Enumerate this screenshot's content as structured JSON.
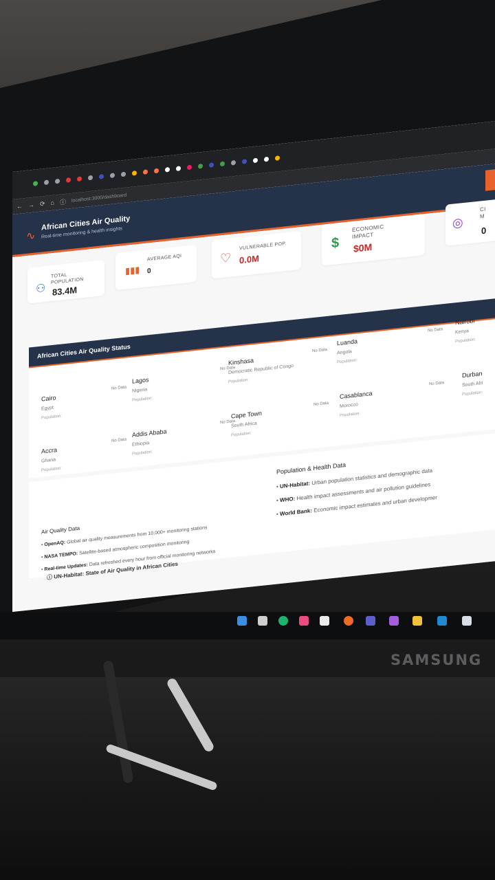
{
  "browser": {
    "url": "localhost:3000/dashboard"
  },
  "header": {
    "title": "African Cities Air Quality",
    "subtitle": "Real-time monitoring & health insights"
  },
  "stats": [
    {
      "label": "TOTAL POPULATION",
      "value": "83.4M",
      "icon": "people-icon",
      "color": "#3b6fd8"
    },
    {
      "label": "AVERAGE AQI",
      "value": "0",
      "icon": "bar-chart-icon",
      "color": "#e8632b"
    },
    {
      "label": "VULNERABLE POP.",
      "value": "0.0M",
      "icon": "heart-icon",
      "color": "#d93a3a"
    },
    {
      "label": "ECONOMIC IMPACT",
      "value": "$0M",
      "icon": "dollar-icon",
      "color": "#2e9a4b"
    },
    {
      "label": "CI M",
      "value": "0",
      "icon": "location-pin-icon",
      "color": "#9b3bd8"
    }
  ],
  "status": {
    "title": "African Cities Air Quality Status",
    "cities": [
      {
        "name": "Cairo",
        "country": "Egypt",
        "population": "Population:",
        "aqi": "No Data"
      },
      {
        "name": "Lagos",
        "country": "Nigeria",
        "population": "Population:",
        "aqi": "No Data"
      },
      {
        "name": "Kinshasa",
        "country": "Democratic Republic of Congo",
        "population": "Population:",
        "aqi": "No Data"
      },
      {
        "name": "Luanda",
        "country": "Angola",
        "population": "Population:",
        "aqi": "No Data"
      },
      {
        "name": "Nairobi",
        "country": "Kenya",
        "population": "Population:",
        "aqi": "No Data"
      },
      {
        "name": "Accra",
        "country": "Ghana",
        "population": "Population:",
        "aqi": "No Data"
      },
      {
        "name": "Addis Ababa",
        "country": "Ethiopia",
        "population": "Population:",
        "aqi": "No Data"
      },
      {
        "name": "Cape Town",
        "country": "South Africa",
        "population": "Population:",
        "aqi": "No Data"
      },
      {
        "name": "Casablanca",
        "country": "Morocco",
        "population": "Population:",
        "aqi": "No Data"
      },
      {
        "name": "Durban",
        "country": "South Afri",
        "population": "Population:",
        "aqi": "No Data"
      }
    ]
  },
  "footer": {
    "air_title": "Air Quality Data",
    "air_items": [
      {
        "bold": "OpenAQ:",
        "text": " Global air quality measurements from 10,000+ monitoring stations"
      },
      {
        "bold": "NASA TEMPO:",
        "text": " Satellite-based atmospheric composition monitoring"
      },
      {
        "bold": "Real-time Updates:",
        "text": " Data refreshed every hour from official monitoring networks"
      }
    ],
    "pop_title": "Population & Health Data",
    "pop_items": [
      {
        "bold": "UN-Habitat:",
        "text": " Urban population statistics and demographic data"
      },
      {
        "bold": "WHO:",
        "text": " Health impact assessments and air pollution guidelines"
      },
      {
        "bold": "World Bank:",
        "text": " Economic impact estimates and urban developmer"
      }
    ],
    "source_link": "UN-Habitat: State of Air Quality in African Cities"
  },
  "monitor_brand": "SAMSUNG"
}
